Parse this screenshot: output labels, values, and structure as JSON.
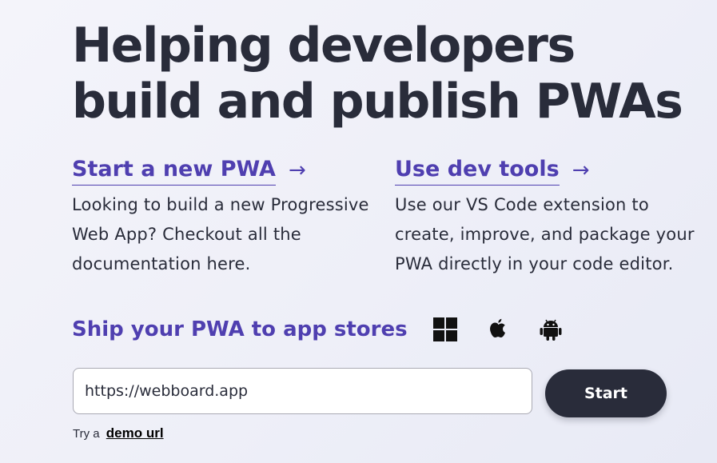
{
  "hero": {
    "title": "Helping developers build and publish PWAs"
  },
  "columns": [
    {
      "link_label": "Start a new PWA",
      "arrow": "→",
      "description": "Looking to build a new Progressive Web App? Checkout all the documentation here."
    },
    {
      "link_label": "Use dev tools",
      "arrow": "→",
      "description": "Use our VS Code extension to create, improve, and package your PWA directly in your code editor."
    }
  ],
  "ship": {
    "title": "Ship your PWA to app stores",
    "stores": [
      "windows-icon",
      "apple-icon",
      "android-icon"
    ]
  },
  "form": {
    "url_value": "https://webboard.app",
    "start_label": "Start",
    "try_prefix": "Try a",
    "demo_link": "demo url"
  },
  "colors": {
    "accent": "#4f3fb0",
    "dark": "#292c3a",
    "background": "#f0f1f8"
  }
}
